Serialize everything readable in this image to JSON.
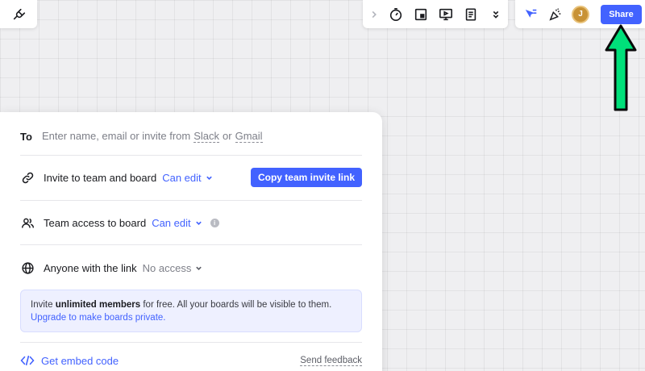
{
  "toolbar": {
    "left_icons": [
      "magic-wand-icon",
      "plug-icon"
    ],
    "mid_icons": [
      "chevron-right-icon",
      "timer-icon",
      "sticky-frame-icon",
      "presentation-icon",
      "notes-icon",
      "chevron-double-down-icon"
    ],
    "right_icons": [
      "reactions-icon",
      "celebrate-icon"
    ],
    "avatar_initial": "J",
    "share_label": "Share"
  },
  "share_panel": {
    "to_label": "To",
    "to_placeholder_prefix": "Enter name, email or invite from",
    "slack": "Slack",
    "or": "or",
    "gmail": "Gmail",
    "invite_team_label": "Invite to team and board",
    "invite_team_permission": "Can edit",
    "copy_link_label": "Copy team invite link",
    "team_access_label": "Team access to board",
    "team_access_permission": "Can edit",
    "info_glyph": "i",
    "anyone_label": "Anyone with the link",
    "anyone_permission": "No access",
    "banner": {
      "prefix": "Invite",
      "bold": "unlimited members",
      "suffix": "for free. All your boards will be visible to them.",
      "link": "Upgrade to make boards private."
    },
    "embed_label": "Get embed code",
    "feedback_label": "Send feedback"
  },
  "colors": {
    "accent": "#4262ff",
    "annotation_arrow": "#00e07a"
  }
}
